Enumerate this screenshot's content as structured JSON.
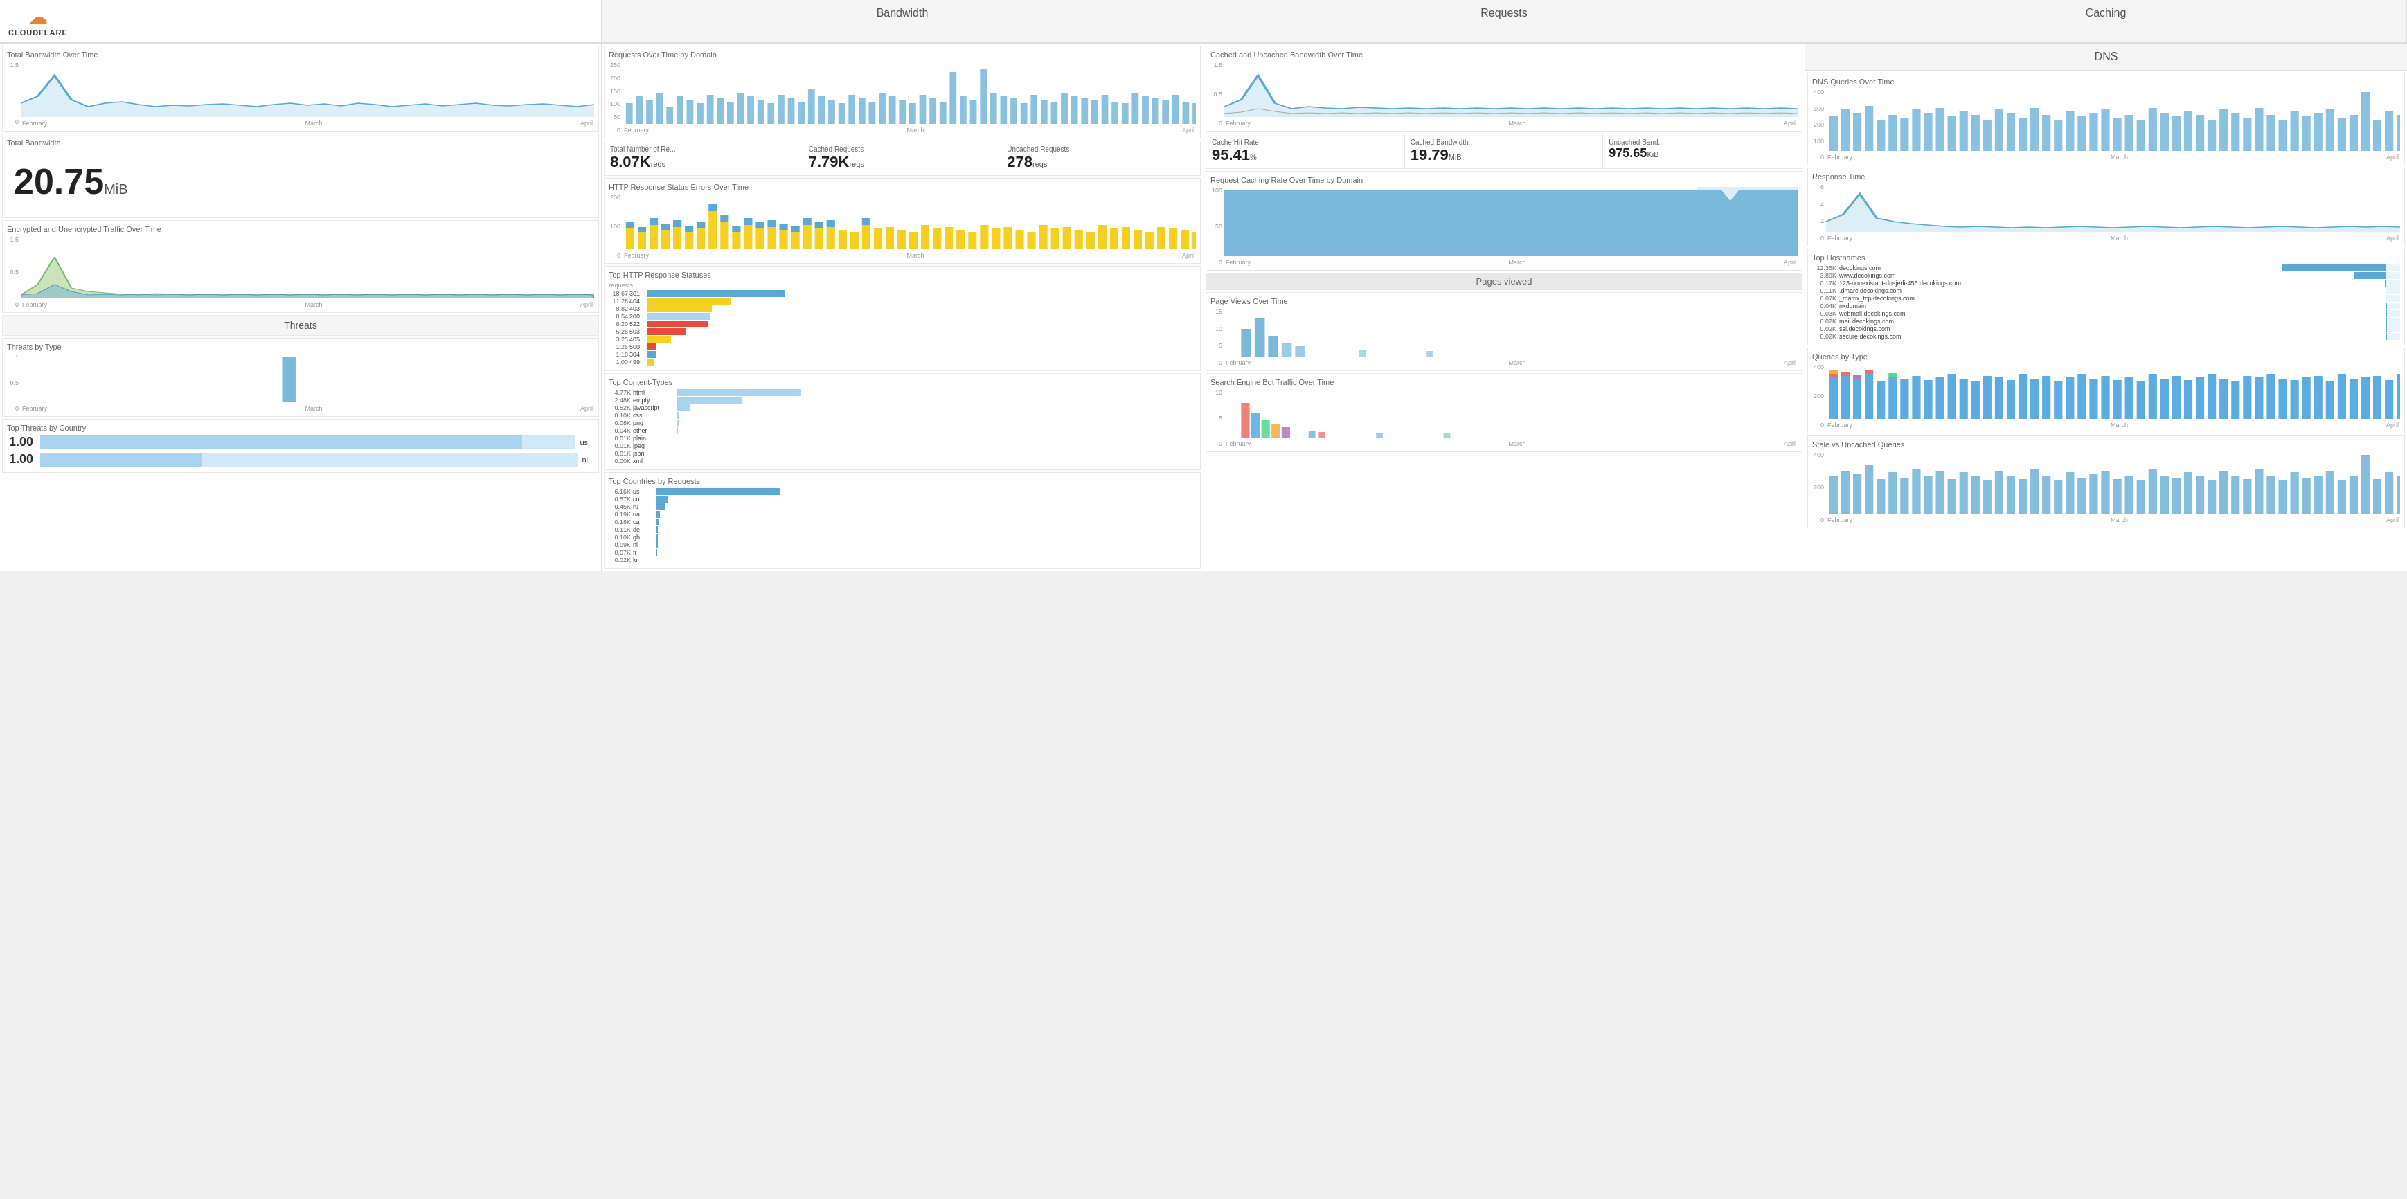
{
  "header": {
    "logo": "CLOUDFLARE",
    "sections": [
      "Bandwidth",
      "Requests",
      "Caching",
      "DNS"
    ]
  },
  "bandwidth": {
    "total_over_time_title": "Total Bandwidth Over Time",
    "total_bandwidth_title": "Total Bandwidth",
    "total_bandwidth_value": "20.75",
    "total_bandwidth_unit": "MiB",
    "encrypted_title": "Encrypted and Unencrypted Traffic Over Time",
    "y_max": "1.5",
    "y_mid": "0.5",
    "x_labels": [
      "February",
      "March",
      "April"
    ]
  },
  "threats": {
    "section_title": "Threats",
    "by_type_title": "Threats by Type",
    "y_max": "1",
    "y_mid": "0.5",
    "x_labels": [
      "February",
      "March",
      "April"
    ],
    "top_by_country_title": "Top Threats by Country",
    "countries": [
      {
        "value": "1.00",
        "code": "us"
      },
      {
        "value": "1.00",
        "code": "nl"
      }
    ]
  },
  "requests": {
    "over_time_title": "Requests Over Time by Domain",
    "y_max": "250",
    "x_labels": [
      "February",
      "March",
      "April"
    ],
    "stats": [
      {
        "label": "Total Number of Re...",
        "value": "8.07K",
        "unit": "reqs"
      },
      {
        "label": "Cached Requests",
        "value": "7.79K",
        "unit": "reqs"
      },
      {
        "label": "Uncached Requests",
        "value": "278",
        "unit": "reqs"
      }
    ],
    "http_errors_title": "HTTP Response Status Errors Over Time",
    "http_errors_y_max": "200",
    "http_errors_y_mid": "100",
    "http_errors_x_labels": [
      "February",
      "March",
      "April"
    ],
    "top_statuses_title": "Top HTTP Response Statuses",
    "statuses": [
      {
        "count": "18.67",
        "code": "301"
      },
      {
        "count": "11.28",
        "code": "404"
      },
      {
        "count": "8.82",
        "code": "403"
      },
      {
        "count": "8.54",
        "code": "200"
      },
      {
        "count": "8.20",
        "code": "522"
      },
      {
        "count": "5.28",
        "code": "503"
      },
      {
        "count": "3.25",
        "code": "405"
      },
      {
        "count": "1.26",
        "code": "500"
      },
      {
        "count": "1.18",
        "code": "304"
      },
      {
        "count": "1.00",
        "code": "499"
      }
    ],
    "top_content_types_title": "Top Content-Types",
    "content_types": [
      {
        "count": "4.77K",
        "type": "html"
      },
      {
        "count": "2.48K",
        "type": "empty"
      },
      {
        "count": "0.52K",
        "type": "javascript"
      },
      {
        "count": "0.10K",
        "type": "css"
      },
      {
        "count": "0.08K",
        "type": "png"
      },
      {
        "count": "0.04K",
        "type": "other"
      },
      {
        "count": "0.01K",
        "type": "plain"
      },
      {
        "count": "0.01K",
        "type": "jpeg"
      },
      {
        "count": "0.01K",
        "type": "json"
      },
      {
        "count": "0.00K",
        "type": "xml"
      }
    ],
    "top_countries_title": "Top Countries by Requests",
    "countries": [
      {
        "count": "6.16K",
        "code": "us"
      },
      {
        "count": "0.57K",
        "code": "cn"
      },
      {
        "count": "0.45K",
        "code": "ru"
      },
      {
        "count": "0.19K",
        "code": "ua"
      },
      {
        "count": "0.18K",
        "code": "ca"
      },
      {
        "count": "0.11K",
        "code": "de"
      },
      {
        "count": "0.10K",
        "code": "gb"
      },
      {
        "count": "0.09K",
        "code": "nl"
      },
      {
        "count": "0.07K",
        "code": "fr"
      },
      {
        "count": "0.02K",
        "code": "kr"
      }
    ]
  },
  "caching": {
    "bandwidth_title": "Cached and Uncached Bandwidth Over Time",
    "y_max": "1.5",
    "y_mid": "0.5",
    "x_labels": [
      "February",
      "March",
      "April"
    ],
    "stats": [
      {
        "label": "Cache Hit Rate",
        "value": "95.41",
        "unit": "%"
      },
      {
        "label": "Cached Bandwidth",
        "value": "19.79",
        "unit": "MiB"
      },
      {
        "label": "Uncached Band...",
        "value": "975.65",
        "unit": "KiB"
      }
    ],
    "caching_rate_title": "Request Caching Rate Over Time by Domain",
    "caching_rate_y_max": "100",
    "caching_rate_y_mid": "50",
    "caching_rate_x_labels": [
      "February",
      "March",
      "April"
    ],
    "pages_viewed_title": "Pages viewed",
    "page_views_title": "Page Views Over Time",
    "page_views_y_max": "15",
    "page_views_y_mid": "10",
    "page_views_y_low": "5",
    "page_views_x_labels": [
      "February",
      "March",
      "April"
    ],
    "search_bot_title": "Search Engine Bot Traffic Over Time",
    "search_bot_y_max": "10",
    "search_bot_y_mid": "5",
    "search_bot_x_labels": [
      "February",
      "March",
      "April"
    ]
  },
  "dns": {
    "queries_title": "DNS Queries Over Time",
    "y_max": "400",
    "y_mid_high": "300",
    "y_mid": "200",
    "y_low": "100",
    "x_labels": [
      "February",
      "March",
      "April"
    ],
    "response_time_title": "Response Time",
    "response_y_max": "6",
    "response_y_mid": "4",
    "response_y_low": "2",
    "response_x_labels": [
      "February",
      "March",
      "April"
    ],
    "top_hostnames_title": "Top Hostnames",
    "hostnames": [
      {
        "count": "12.35K",
        "name": "decokings.com"
      },
      {
        "count": "3.89K",
        "name": "www.decokings.com"
      },
      {
        "count": "0.17K",
        "name": "123-nonexistant-dnsjedi-456.decokings.com"
      },
      {
        "count": "0.11K",
        "name": ".dmarc.decokings.com"
      },
      {
        "count": "0.07K",
        "name": "_matrix_tcp.decokings.com"
      },
      {
        "count": "0.04K",
        "name": "nxdomain"
      },
      {
        "count": "0.03K",
        "name": "webmail.decokings.com"
      },
      {
        "count": "0.02K",
        "name": "mail.decokings.com"
      },
      {
        "count": "0.02K",
        "name": "ssl.decokings.com"
      },
      {
        "count": "0.02K",
        "name": "secure.decokings.com"
      }
    ],
    "queries_by_type_title": "Queries by Type",
    "queries_type_y_max": "400",
    "queries_type_y_mid": "200",
    "queries_type_x_labels": [
      "February",
      "March",
      "April"
    ],
    "stale_title": "Stale vs Uncached Queries",
    "stale_y_max": "400",
    "stale_y_mid": "200",
    "stale_x_labels": [
      "February",
      "March",
      "April"
    ]
  }
}
